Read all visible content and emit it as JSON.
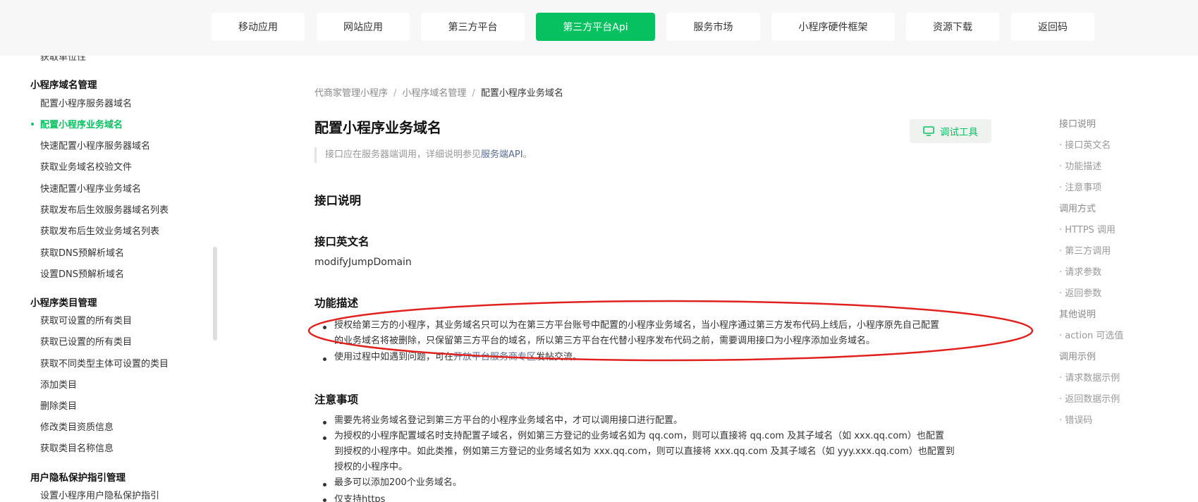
{
  "topnav": [
    {
      "label": "移动应用"
    },
    {
      "label": "网站应用"
    },
    {
      "label": "第三方平台"
    },
    {
      "label": "第三方平台Api",
      "active": true
    },
    {
      "label": "服务市场"
    },
    {
      "label": "小程序硬件框架"
    },
    {
      "label": "资源下载"
    },
    {
      "label": "返回码"
    }
  ],
  "sidebar": {
    "clipped_item": "获取单位性",
    "groups": [
      {
        "title": "小程序域名管理",
        "items": [
          {
            "label": "配置小程序服务器域名"
          },
          {
            "label": "配置小程序业务域名",
            "active": true
          },
          {
            "label": "快速配置小程序服务器域名"
          },
          {
            "label": "获取业务域名校验文件"
          },
          {
            "label": "快速配置小程序业务域名"
          },
          {
            "label": "获取发布后生效服务器域名列表"
          },
          {
            "label": "获取发布后生效业务域名列表"
          },
          {
            "label": "获取DNS预解析域名"
          },
          {
            "label": "设置DNS预解析域名"
          }
        ]
      },
      {
        "title": "小程序类目管理",
        "items": [
          {
            "label": "获取可设置的所有类目"
          },
          {
            "label": "获取已设置的所有类目"
          },
          {
            "label": "获取不同类型主体可设置的类目"
          },
          {
            "label": "添加类目"
          },
          {
            "label": "删除类目"
          },
          {
            "label": "修改类目资质信息"
          },
          {
            "label": "获取类目名称信息"
          }
        ]
      },
      {
        "title": "用户隐私保护指引管理",
        "items": [
          {
            "label": "设置小程序用户隐私保护指引"
          }
        ]
      }
    ]
  },
  "breadcrumb": {
    "items": [
      "代商家管理小程序",
      "小程序域名管理"
    ],
    "separator": "/",
    "current": "配置小程序业务域名"
  },
  "page": {
    "title": "配置小程序业务域名",
    "debug_button": "调试工具",
    "note_prefix": "接口应在服务器端调用，详细说明参见",
    "note_link": "服务端API",
    "note_suffix": "。"
  },
  "sections": {
    "api_desc": "接口说明",
    "api_name_title": "接口英文名",
    "api_name": "modifyJumpDomain",
    "func_title": "功能描述",
    "func_p1_line1": "授权给第三方的小程序，其业务域名只可以为在第三方平台账号中配置的小程序业务域名，当小程序通过第三方发布代码上线后，小程序原先自己配置",
    "func_p1_line2": "的业务域名将被删除，只保留第三方平台的域名，所以第三方平台在代替小程序发布代码之前，需要调用接口为小程序添加业务域名。",
    "func_p2_prefix": "使用过程中如遇到问题，可在",
    "func_p2_link": "开放平台服务商专区",
    "func_p2_suffix": "发帖交流。",
    "notes_title": "注意事项",
    "note1": "需要先将业务域名登记到第三方平台的小程序业务域名中，才可以调用接口进行配置。",
    "note2_line1": "为授权的小程序配置域名时支持配置子域名，例如第三方登记的业务域名如为 qq.com，则可以直接将 qq.com 及其子域名（如 xxx.qq.com）也配置",
    "note2_line2": "到授权的小程序中。如此类推，例如第三方登记的业务域名如为 xxx.qq.com，则可以直接将 xxx.qq.com 及其子域名（如 yyy.xxx.qq.com）也配置到",
    "note2_line3": "授权的小程序中。",
    "note3": "最多可以添加200个业务域名。",
    "note4": "仅支持https"
  },
  "toc": [
    {
      "label": "接口说明",
      "level": 1
    },
    {
      "label": "· 接口英文名",
      "level": 2
    },
    {
      "label": "· 功能描述",
      "level": 2
    },
    {
      "label": "· 注意事项",
      "level": 2
    },
    {
      "label": "调用方式",
      "level": 1
    },
    {
      "label": "· HTTPS 调用",
      "level": 2
    },
    {
      "label": "· 第三方调用",
      "level": 2
    },
    {
      "label": "· 请求参数",
      "level": 2
    },
    {
      "label": "· 返回参数",
      "level": 2
    },
    {
      "label": "其他说明",
      "level": 1
    },
    {
      "label": "· action 可选值",
      "level": 2
    },
    {
      "label": "调用示例",
      "level": 1
    },
    {
      "label": "· 请求数据示例",
      "level": 2
    },
    {
      "label": "· 返回数据示例",
      "level": 2
    },
    {
      "label": "· 错误码",
      "level": 2
    }
  ],
  "colors": {
    "accent": "#07c160",
    "annotation": "#e0221f",
    "link": "#576b95"
  }
}
